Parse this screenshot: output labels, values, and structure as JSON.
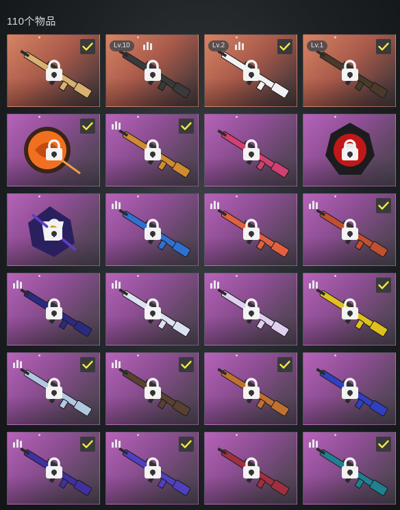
{
  "header": {
    "item_count": "110个物品"
  },
  "colors": {
    "orange_card": "#c06a55",
    "purple_card": "#9b55a0",
    "check": "#f5e94a"
  },
  "items": [
    {
      "rarity": "orange",
      "art": "rifle",
      "accent": "#d8b070",
      "checked": true,
      "level": "",
      "bars": false
    },
    {
      "rarity": "orange",
      "art": "rifle",
      "accent": "#3a3a3a",
      "checked": false,
      "level": "Lv.10",
      "bars": true
    },
    {
      "rarity": "orange",
      "art": "rifle",
      "accent": "#f2f2f2",
      "checked": true,
      "level": "Lv.2",
      "bars": true
    },
    {
      "rarity": "orange",
      "art": "rifle",
      "accent": "#4a3a2a",
      "checked": true,
      "level": "Lv.1",
      "bars": false
    },
    {
      "rarity": "purple",
      "art": "emblem-orange",
      "accent": "#f07020",
      "checked": true,
      "level": "",
      "bars": false
    },
    {
      "rarity": "purple",
      "art": "rifle",
      "accent": "#d08a30",
      "checked": true,
      "level": "",
      "bars": true
    },
    {
      "rarity": "purple",
      "art": "rifle",
      "accent": "#d04070",
      "checked": false,
      "level": "",
      "bars": false
    },
    {
      "rarity": "purple",
      "art": "emblem-red",
      "accent": "#c01818",
      "checked": false,
      "level": "",
      "bars": false
    },
    {
      "rarity": "purple",
      "art": "emblem-purple",
      "accent": "#5a40c0",
      "checked": false,
      "level": "",
      "bars": false
    },
    {
      "rarity": "purple",
      "art": "rifle",
      "accent": "#3070d0",
      "checked": false,
      "level": "",
      "bars": true
    },
    {
      "rarity": "purple",
      "art": "rifle",
      "accent": "#e06040",
      "checked": false,
      "level": "",
      "bars": true
    },
    {
      "rarity": "purple",
      "art": "rifle",
      "accent": "#c05030",
      "checked": true,
      "level": "",
      "bars": true
    },
    {
      "rarity": "purple",
      "art": "rifle",
      "accent": "#2a2a80",
      "checked": false,
      "level": "",
      "bars": true
    },
    {
      "rarity": "purple",
      "art": "rifle",
      "accent": "#dde0f0",
      "checked": false,
      "level": "",
      "bars": true
    },
    {
      "rarity": "purple",
      "art": "rifle",
      "accent": "#e0d0f0",
      "checked": false,
      "level": "",
      "bars": true
    },
    {
      "rarity": "purple",
      "art": "rifle",
      "accent": "#e0c020",
      "checked": true,
      "level": "",
      "bars": true
    },
    {
      "rarity": "purple",
      "art": "rifle",
      "accent": "#b0c8e0",
      "checked": true,
      "level": "",
      "bars": true
    },
    {
      "rarity": "purple",
      "art": "rifle",
      "accent": "#5a4030",
      "checked": true,
      "level": "",
      "bars": true
    },
    {
      "rarity": "purple",
      "art": "rifle",
      "accent": "#c07030",
      "checked": true,
      "level": "",
      "bars": false
    },
    {
      "rarity": "purple",
      "art": "rifle",
      "accent": "#3040c0",
      "checked": false,
      "level": "",
      "bars": false
    },
    {
      "rarity": "purple",
      "art": "rifle",
      "accent": "#4030a0",
      "checked": true,
      "level": "",
      "bars": true
    },
    {
      "rarity": "purple",
      "art": "rifle",
      "accent": "#5040c0",
      "checked": true,
      "level": "",
      "bars": true
    },
    {
      "rarity": "purple",
      "art": "rifle",
      "accent": "#a03040",
      "checked": false,
      "level": "",
      "bars": false
    },
    {
      "rarity": "purple",
      "art": "rifle",
      "accent": "#208090",
      "checked": true,
      "level": "",
      "bars": true
    }
  ]
}
